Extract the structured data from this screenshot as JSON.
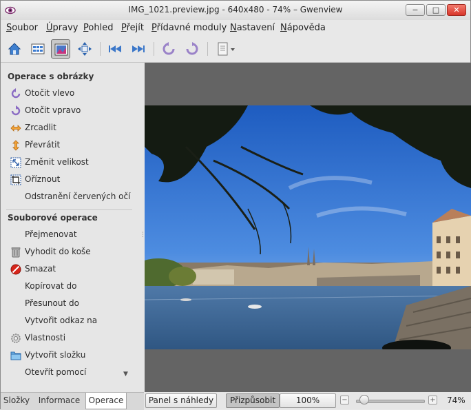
{
  "window": {
    "title": "IMG_1021.preview.jpg - 640x480 - 74% – Gwenview"
  },
  "menubar": {
    "items": [
      "Soubor",
      "Úpravy",
      "Pohled",
      "Přejít",
      "Přídavné moduly",
      "Nastavení",
      "Nápověda"
    ]
  },
  "toolbar": {
    "buttons": [
      "home-icon",
      "thumbnails-icon",
      "view-image-icon",
      "fullscreen-icon",
      "previous-icon",
      "next-icon",
      "rotate-left-icon",
      "rotate-right-icon",
      "document-menu-icon"
    ],
    "active": "view-image-icon"
  },
  "sidebar": {
    "image_ops_title": "Operace s obrázky",
    "image_ops": [
      "Otočit vlevo",
      "Otočit vpravo",
      "Zrcadlit",
      "Převrátit",
      "Změnit velikost",
      "Oříznout",
      "Odstranění červených očí"
    ],
    "file_ops_title": "Souborové operace",
    "file_ops": [
      "Přejmenovat",
      "Vyhodit do koše",
      "Smazat",
      "Kopírovat do",
      "Přesunout do",
      "Vytvořit odkaz na",
      "Vlastnosti",
      "Vytvořit složku",
      "Otevřít pomocí"
    ]
  },
  "tabs": {
    "items": [
      "Složky",
      "Informace",
      "Operace"
    ],
    "selected": "Operace"
  },
  "statusbar": {
    "thumbnail_panel": "Panel s náhledy",
    "fit": "Přizpůsobit",
    "zoom_100": "100%",
    "zoom_percent": "74%",
    "zoom_level": 0.05
  },
  "colors": {
    "sky": "#2f6fcf",
    "viewer_bg": "#646464"
  }
}
